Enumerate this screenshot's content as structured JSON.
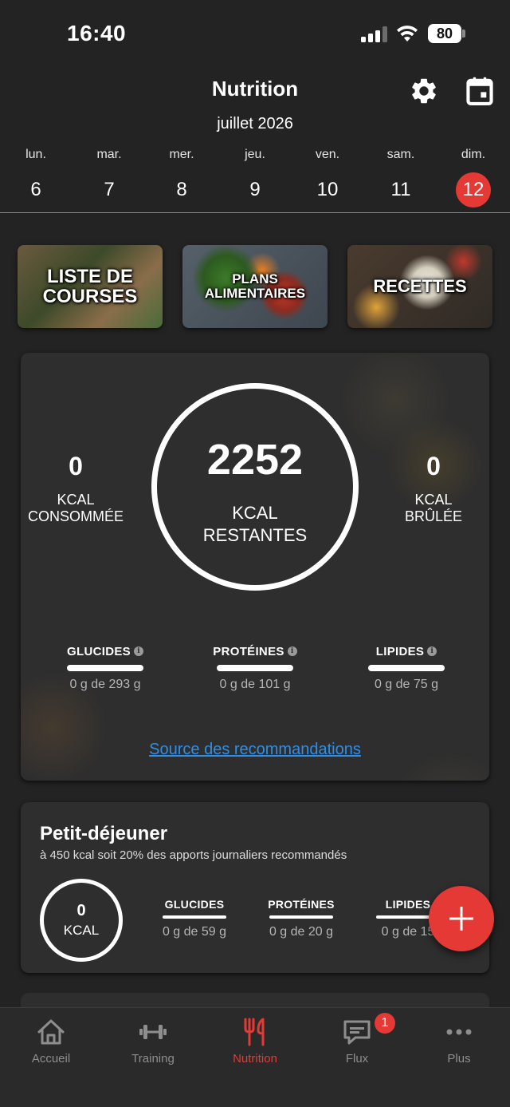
{
  "status_bar": {
    "time": "16:40",
    "battery": "80"
  },
  "header": {
    "title": "Nutrition",
    "month": "juillet 2026"
  },
  "week": [
    {
      "day": "lun.",
      "date": "6"
    },
    {
      "day": "mar.",
      "date": "7"
    },
    {
      "day": "mer.",
      "date": "8"
    },
    {
      "day": "jeu.",
      "date": "9"
    },
    {
      "day": "ven.",
      "date": "10"
    },
    {
      "day": "sam.",
      "date": "11"
    },
    {
      "day": "dim.",
      "date": "12",
      "selected": true
    }
  ],
  "tiles": [
    {
      "label": "LISTE DE COURSES"
    },
    {
      "label": "PLANS ALIMENTAIRES"
    },
    {
      "label": "RECETTES"
    }
  ],
  "summary": {
    "consumed": {
      "value": "0",
      "label": "KCAL\nCONSOMMÉE"
    },
    "remaining": {
      "value": "2252",
      "label": "KCAL\nRESTANTES"
    },
    "burned": {
      "value": "0",
      "label": "KCAL\nBRÛLÉE"
    },
    "macros": [
      {
        "name": "GLUCIDES",
        "value": "0 g de 293 g",
        "progress": 0
      },
      {
        "name": "PROTÉINES",
        "value": "0 g de 101 g",
        "progress": 0
      },
      {
        "name": "LIPIDES",
        "value": "0 g de 75 g",
        "progress": 0
      }
    ],
    "source_link": "Source des recommandations"
  },
  "meal": {
    "title": "Petit-déjeuner",
    "subtitle": "à 450 kcal soit 20% des apports journaliers recommandés",
    "kcal_value": "0",
    "kcal_label": "KCAL",
    "macros": [
      {
        "name": "GLUCIDES",
        "value": "0 g de 59 g"
      },
      {
        "name": "PROTÉINES",
        "value": "0 g de 20 g"
      },
      {
        "name": "LIPIDES",
        "value": "0 g de 15"
      }
    ]
  },
  "tabs": [
    {
      "label": "Accueil",
      "icon": "home-icon"
    },
    {
      "label": "Training",
      "icon": "dumbbell-icon"
    },
    {
      "label": "Nutrition",
      "icon": "fork-knife-icon",
      "active": true
    },
    {
      "label": "Flux",
      "icon": "chat-icon",
      "badge": "1"
    },
    {
      "label": "Plus",
      "icon": "more-icon"
    }
  ],
  "colors": {
    "accent": "#e53935",
    "link": "#2f8fe8",
    "background": "#232323",
    "card": "#2e2e2e"
  }
}
